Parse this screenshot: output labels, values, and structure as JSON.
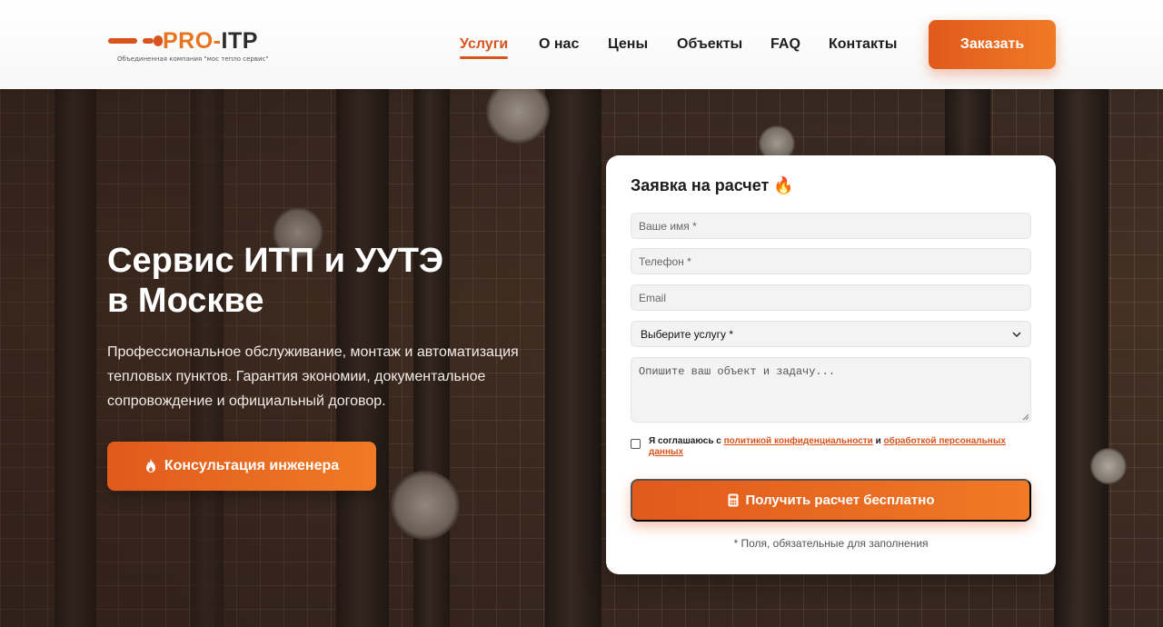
{
  "logo": {
    "text_part1": "PRO-",
    "text_part2": "ITP",
    "subtitle": "Объединенная компания \"мос тепло сервис\""
  },
  "nav": {
    "items": [
      {
        "label": "Услуги",
        "active": true
      },
      {
        "label": "О нас",
        "active": false
      },
      {
        "label": "Цены",
        "active": false
      },
      {
        "label": "Объекты",
        "active": false
      },
      {
        "label": "FAQ",
        "active": false
      },
      {
        "label": "Контакты",
        "active": false
      }
    ],
    "order_label": "Заказать"
  },
  "hero": {
    "title_line1": "Сервис ИТП и УУТЭ",
    "title_line2": "в Москве",
    "description": "Профессиональное обслуживание, монтаж и автоматизация тепловых пунктов. Гарантия экономии, документальное сопровождение и официальный договор.",
    "consult_label": "Консультация инженера"
  },
  "form": {
    "title": "Заявка на расчет 🔥",
    "name_placeholder": "Ваше имя *",
    "phone_placeholder": "Телефон *",
    "email_placeholder": "Email",
    "service_selected": "Выберите услугу *",
    "message_placeholder": "Опишите ваш объект и задачу...",
    "consent_prefix": "Я соглашаюсь с ",
    "consent_link1": "политикой конфиденциальности",
    "consent_and": " и ",
    "consent_link2": "обработкой персональных данных",
    "submit_label": "Получить расчет бесплатно",
    "required_note": "* Поля, обязательные для заполнения"
  },
  "colors": {
    "accent": "#e05a1c",
    "accent_light": "#f07a25",
    "logo_orange": "#e8741f"
  }
}
